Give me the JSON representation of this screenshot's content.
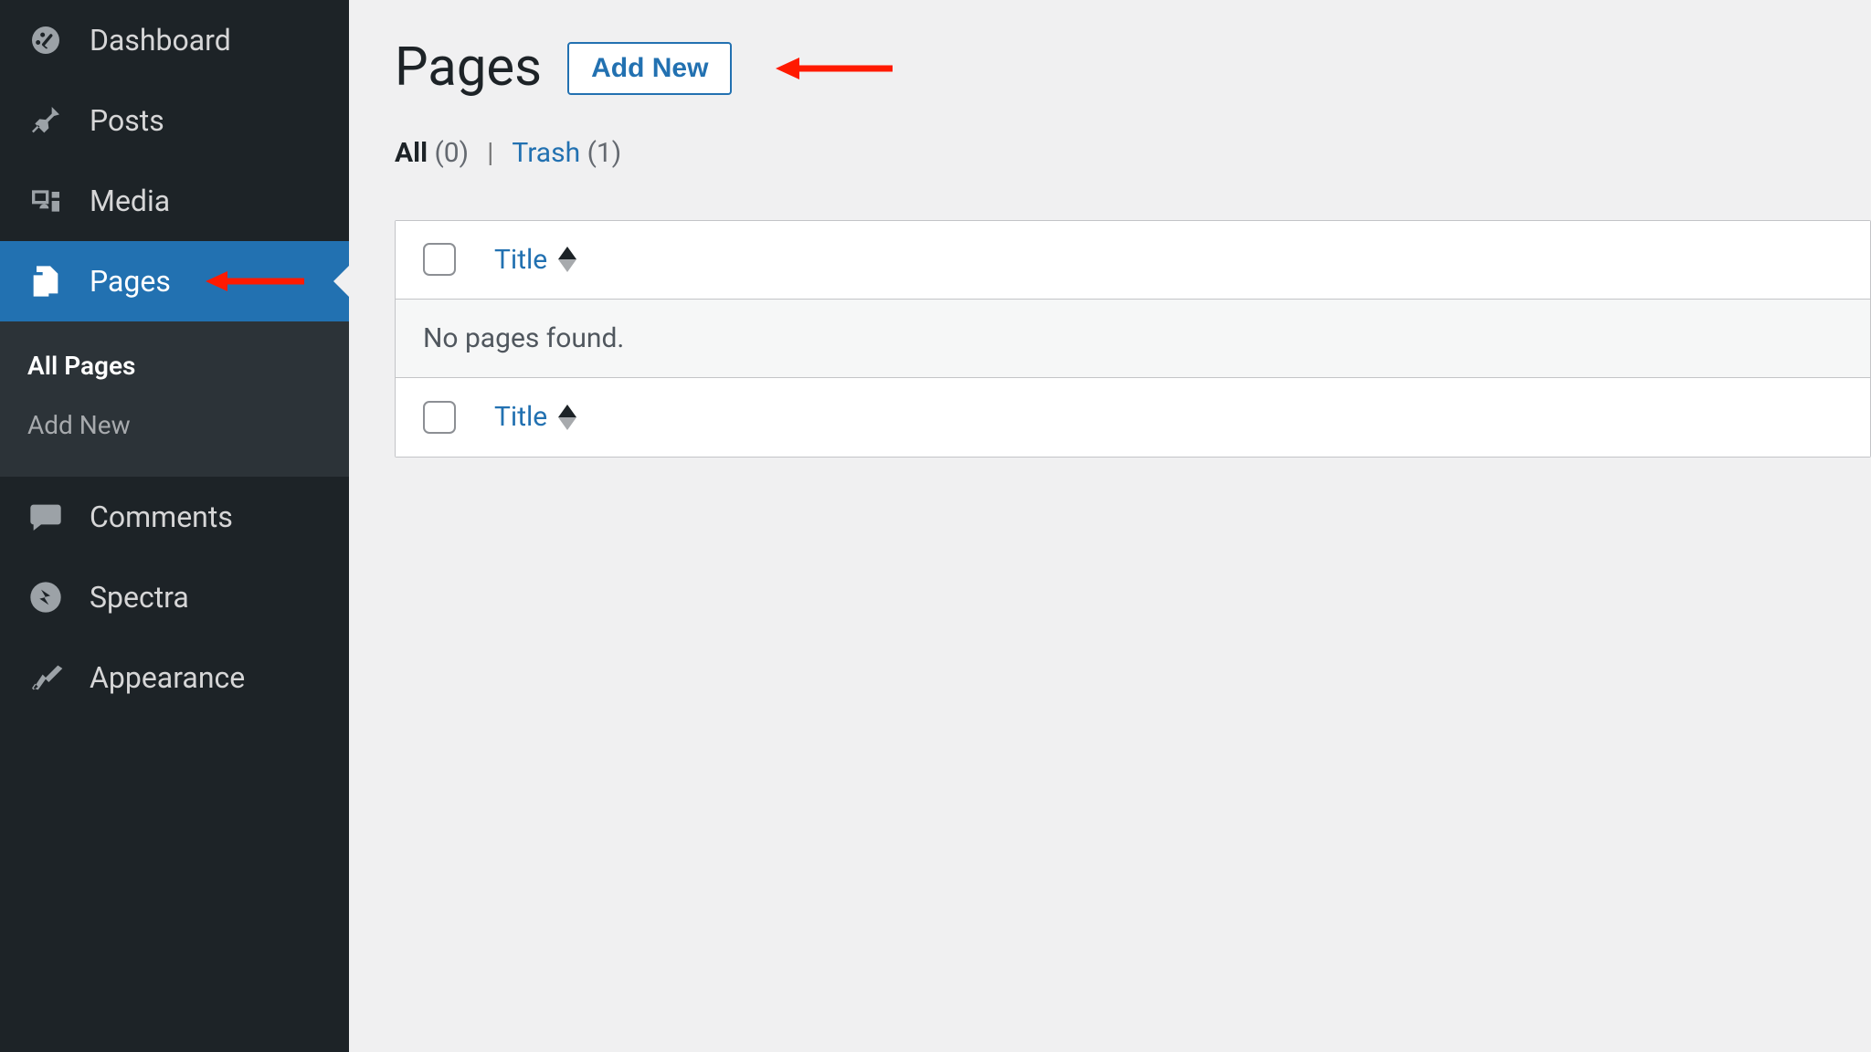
{
  "sidebar": {
    "items": [
      {
        "label": "Dashboard"
      },
      {
        "label": "Posts"
      },
      {
        "label": "Media"
      },
      {
        "label": "Pages"
      },
      {
        "label": "Comments"
      },
      {
        "label": "Spectra"
      },
      {
        "label": "Appearance"
      }
    ],
    "submenu": {
      "all_pages": "All Pages",
      "add_new": "Add New"
    }
  },
  "header": {
    "title": "Pages",
    "add_new_label": "Add New"
  },
  "filters": {
    "all_label": "All",
    "all_count": "(0)",
    "separator": "|",
    "trash_label": "Trash",
    "trash_count": "(1)"
  },
  "table": {
    "title_column": "Title",
    "empty_message": "No pages found."
  }
}
